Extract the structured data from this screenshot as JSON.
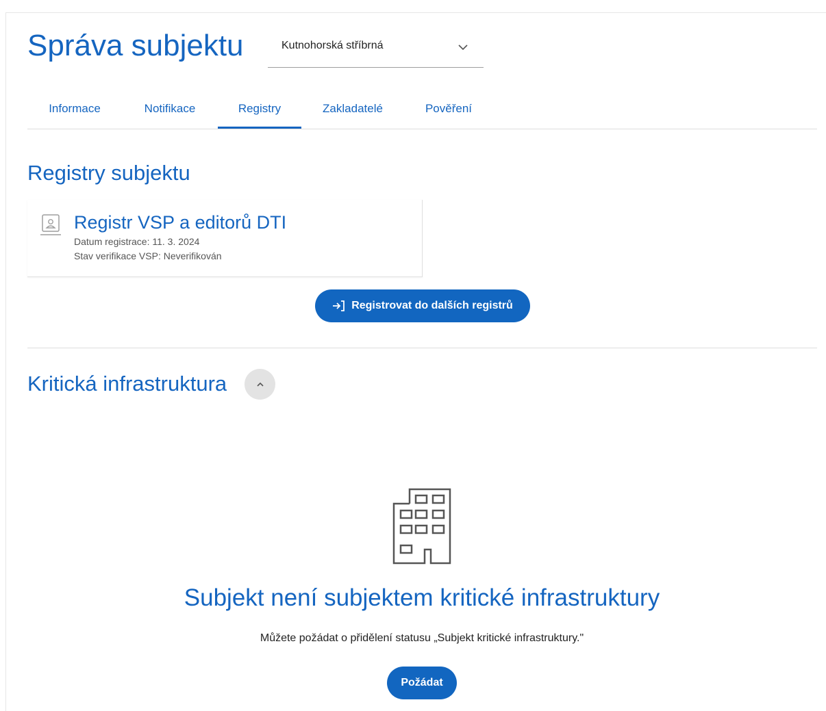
{
  "header": {
    "title": "Správa subjektu",
    "subject_select": {
      "value": "Kutnohorská stříbrná",
      "icon": "chevron-down-icon"
    }
  },
  "tabs": [
    {
      "label": "Informace",
      "active": false
    },
    {
      "label": "Notifikace",
      "active": false
    },
    {
      "label": "Registry",
      "active": true
    },
    {
      "label": "Zakladatelé",
      "active": false
    },
    {
      "label": "Pověření",
      "active": false
    }
  ],
  "registries": {
    "title": "Registry subjektu",
    "items": [
      {
        "icon": "id-card-icon",
        "name": "Registr VSP a editorů DTI",
        "date_line": "Datum registrace: 11. 3. 2024",
        "status_line": "Stav verifikace VSP: Neverifikován"
      }
    ],
    "register_button": {
      "icon": "login-arrow-icon",
      "label": "Registrovat do dalších registrů"
    }
  },
  "critical_infrastructure": {
    "title": "Kritická infrastruktura",
    "collapse_icon": "chevron-up-icon",
    "empty_state": {
      "icon": "building-icon",
      "title": "Subjekt není subjektem kritické infrastruktury",
      "text": "Můžete požádat o přidělení statusu „Subjekt kritické infrastruktury.\"",
      "button_label": "Požádat"
    }
  },
  "colors": {
    "accent": "#1565c0",
    "button": "#1266c0",
    "divider": "#dddddd",
    "collapse_bg": "#e3e3e3"
  }
}
